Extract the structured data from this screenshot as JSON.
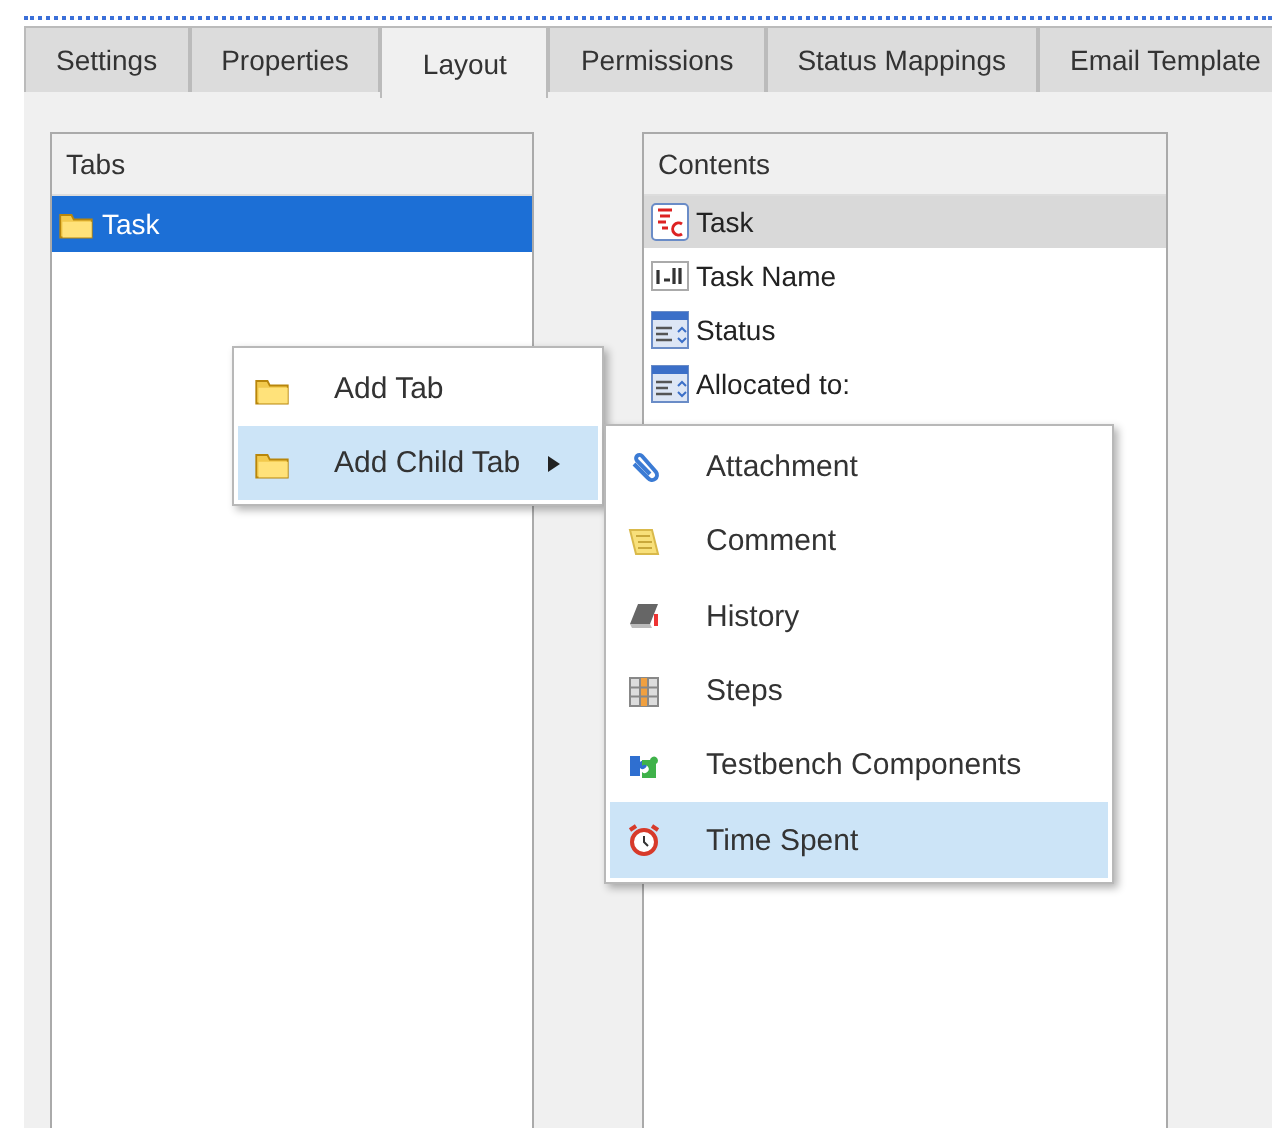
{
  "tabs": [
    {
      "label": "Settings",
      "selected": false
    },
    {
      "label": "Properties",
      "selected": false
    },
    {
      "label": "Layout",
      "selected": true
    },
    {
      "label": "Permissions",
      "selected": false
    },
    {
      "label": "Status Mappings",
      "selected": false
    },
    {
      "label": "Email Template",
      "selected": false
    }
  ],
  "tabs_panel": {
    "title": "Tabs",
    "items": [
      {
        "label": "Task",
        "selected": true
      }
    ]
  },
  "contents_panel": {
    "title": "Contents",
    "items": [
      {
        "label": "Task",
        "selected": true
      },
      {
        "label": "Task Name",
        "selected": false
      },
      {
        "label": "Status",
        "selected": false
      },
      {
        "label": "Allocated to:",
        "selected": false
      }
    ]
  },
  "context_menu": {
    "items": [
      {
        "label": "Add Tab",
        "selected": false,
        "submenu": false
      },
      {
        "label": "Add Child Tab",
        "selected": true,
        "submenu": true
      }
    ]
  },
  "submenu": {
    "items": [
      {
        "label": "Attachment",
        "selected": false
      },
      {
        "label": "Comment",
        "selected": false
      },
      {
        "label": "History",
        "selected": false
      },
      {
        "label": "Steps",
        "selected": false
      },
      {
        "label": "Testbench Components",
        "selected": false
      },
      {
        "label": "Time Spent",
        "selected": true
      }
    ]
  }
}
